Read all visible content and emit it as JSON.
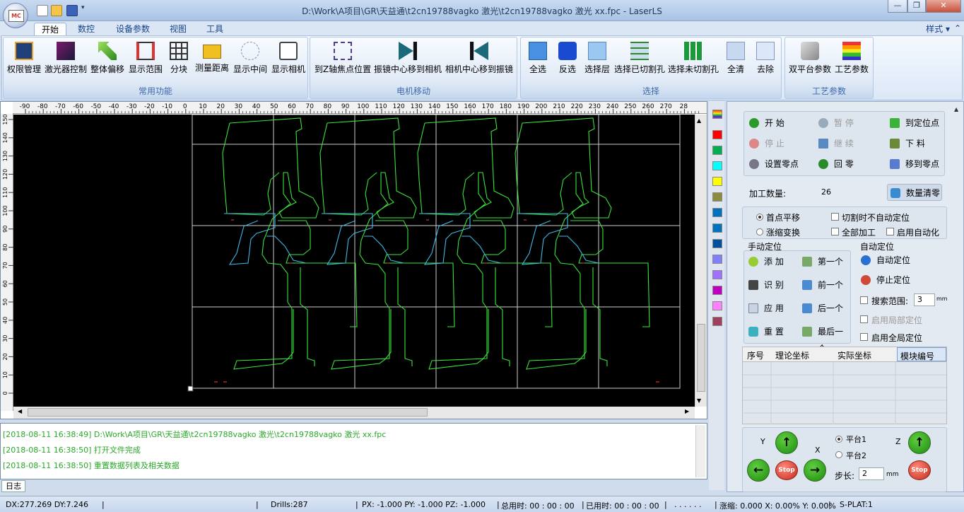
{
  "window": {
    "title": "D:\\Work\\A项目\\GR\\天益通\\t2cn19788vagko  激光\\t2cn19788vagko 激光 xx.fpc - LaserLS",
    "minimize": "—",
    "restore": "❐",
    "close": "✕"
  },
  "app_logo": "MC",
  "tabs": [
    "开始",
    "数控",
    "设备参数",
    "视图",
    "工具"
  ],
  "style_menu": "样式 ▾",
  "ribbon": {
    "groups": [
      {
        "label": "常用功能",
        "buttons": [
          "权限管理",
          "激光器控制",
          "整体偏移",
          "显示范围",
          "分块",
          "测量距离",
          "显示中间",
          "显示相机"
        ]
      },
      {
        "label": "电机移动",
        "buttons": [
          "到Z轴焦点位置",
          "振镜中心移到相机",
          "相机中心移到振镜"
        ]
      },
      {
        "label": "选择",
        "buttons": [
          "全选",
          "反选",
          "选择层",
          "选择已切割孔",
          "选择未切割孔",
          "全清",
          "去除"
        ]
      },
      {
        "label": "工艺参数",
        "buttons": [
          "双平台参数",
          "工艺参数"
        ]
      }
    ]
  },
  "ruler": {
    "top_ticks": [
      "-90",
      "-80",
      "-70",
      "-60",
      "-50",
      "-40",
      "-30",
      "-20",
      "-10",
      "0",
      "10",
      "20",
      "30",
      "40",
      "50",
      "60",
      "70",
      "80",
      "90",
      "100",
      "110",
      "120",
      "130",
      "140",
      "150",
      "160",
      "170",
      "180",
      "190",
      "200",
      "210",
      "220",
      "230",
      "240",
      "250",
      "260",
      "270",
      "28"
    ],
    "left_ticks": [
      "150",
      "140",
      "130",
      "120",
      "110",
      "100",
      "90",
      "80",
      "70",
      "60",
      "50",
      "40",
      "30",
      "20",
      "10",
      "0"
    ]
  },
  "palette_colors": [
    "#ff0000",
    "#00b050",
    "#00ffff",
    "#ffff00",
    "#8c8c3c",
    "#0070c0",
    "#0070c0",
    "#0050a0",
    "#8080ff",
    "#a070ff",
    "#c000c0",
    "#ff80ff",
    "#a04060"
  ],
  "log": {
    "lines": [
      "[2018-08-11 16:38:49]  D:\\Work\\A项目\\GR\\天益通\\t2cn19788vagko  激光\\t2cn19788vagko 激光 xx.fpc",
      "[2018-08-11 16:38:50]  打开文件完成",
      "[2018-08-11 16:38:50]  重置数据列表及相关数据"
    ],
    "tab": "日志"
  },
  "control": {
    "start": "开    始",
    "pause": "暂    停",
    "goto_pos": "到定位点",
    "stop": "停    止",
    "resume": "继    续",
    "unload": "下    料",
    "set_zero": "设置零点",
    "home": "回    零",
    "move_zero": "移到零点",
    "count_label": "加工数量:",
    "count_value": "26",
    "count_clear": "数量清零"
  },
  "options": {
    "first_pan": "首点平移",
    "scale_transform": "涨缩变换",
    "no_auto_locate": "切割时不自动定位",
    "all_process": "全部加工",
    "enable_auto": "启用自动化"
  },
  "manual": {
    "title": "手动定位",
    "add": "添    加",
    "first": "第一个",
    "identify": "识    别",
    "prev": "前一个",
    "apply": "应    用",
    "next": "后一个",
    "reset": "重    置",
    "last": "最后一个"
  },
  "auto": {
    "title": "自动定位",
    "start": "自动定位",
    "stop": "停止定位",
    "search_range": "搜索范围:",
    "search_value": "3",
    "unit": "mm",
    "local": "启用局部定位",
    "global": "启用全局定位"
  },
  "grid": {
    "headers": [
      "序号",
      "理论坐标",
      "实际坐标",
      "模块编号"
    ]
  },
  "motion": {
    "y": "Y",
    "x": "X",
    "z": "Z",
    "platform1": "平台1",
    "platform2": "平台2",
    "step_label": "步长:",
    "step_value": "2",
    "unit": "mm",
    "stop": "Stop"
  },
  "status": {
    "dxdy": "DX:277.269 DY:7.246",
    "drills": "Drills:287",
    "pos": "PX: -1.000  PY: -1.000  PZ: -1.000",
    "total_time": "总用时: 00 : 00 : 00",
    "used_time": "已用时: 00 : 00 : 00",
    "dots": ". . . . . .",
    "scale": "涨缩: 0.000 X: 0.00% Y: 0.00%",
    "platform": "S-PLAT:1"
  }
}
